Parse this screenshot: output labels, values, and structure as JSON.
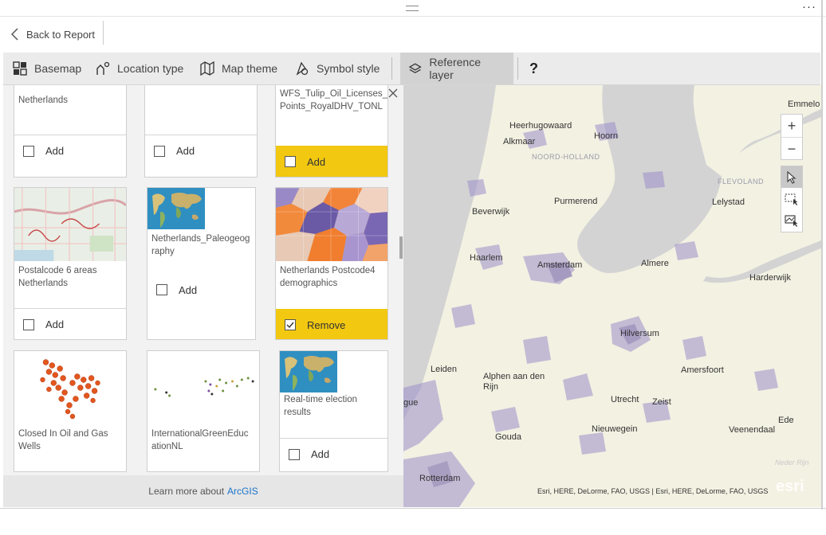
{
  "nav": {
    "back_label": "Back to Report"
  },
  "window": {
    "more_glyph": "···"
  },
  "toolbar": {
    "items": [
      {
        "label": "Basemap",
        "icon": "basemap-icon"
      },
      {
        "label": "Location type",
        "icon": "location-type-icon"
      },
      {
        "label": "Map theme",
        "icon": "map-theme-icon"
      },
      {
        "label": "Symbol style",
        "icon": "symbol-style-icon"
      },
      {
        "label": "Reference layer",
        "icon": "reference-layer-icon",
        "active": true
      }
    ],
    "help": "?"
  },
  "panel": {
    "cards": [
      {
        "title": "Netherlands",
        "action": "Add",
        "checked": false
      },
      {
        "title": "",
        "action": "Add",
        "checked": false
      },
      {
        "title": "WFS_Tulip_Oil_Licenses_\nPoints_RoyalDHV_TONL",
        "action": "Add",
        "checked": false,
        "highlight": true
      },
      {
        "title": "Postalcode 6 areas\nNetherlands",
        "action": "Add",
        "checked": false
      },
      {
        "title": "Netherlands_Paleogeog\nraphy",
        "action": "Add",
        "checked": false
      },
      {
        "title": "Netherlands Postcode4\ndemographics",
        "action": "Remove",
        "checked": true,
        "highlight": true
      },
      {
        "title": "Closed In Oil and Gas\nWells"
      },
      {
        "title": "InternationalGreenEduc\nationNL"
      },
      {
        "title": "Real-time election\nresults",
        "action": "Add",
        "checked": false
      }
    ],
    "footer_text": "Learn more about",
    "footer_link": "ArcGIS"
  },
  "map": {
    "labels": {
      "heerhugowaard": "Heerhugowaard",
      "hoorn": "Hoorn",
      "alkmaar": "Alkmaar",
      "noord_holland": "NOORD-HOLLAND",
      "emmeloord": "Emmelo",
      "flevoland": "FLEVOLAND",
      "lelystad": "Lelystad",
      "beverwijk": "Beverwijk",
      "purmerend": "Purmerend",
      "haarlem": "Haarlem",
      "amsterdam": "Amsterdam",
      "almere": "Almere",
      "harderwijk": "Harderwijk",
      "hilversum": "Hilversum",
      "leiden": "Leiden",
      "alphen": "Alphen aan den\nRijn",
      "amersfoort": "Amersfoort",
      "utrecht": "Utrecht",
      "zeist": "Zeist",
      "ede": "Ede",
      "nieuwegein": "Nieuwegein",
      "veenendaal": "Veenendaal",
      "gouda": "Gouda",
      "gue": "gue",
      "rotterdam": "Rotterdam",
      "neder_rijn": "Neder Rijn"
    },
    "attribution": "Esri, HERE, DeLorme, FAO, USGS | Esri, HERE, DeLorme, FAO, USGS",
    "logo": "esri",
    "zoom_in": "+",
    "zoom_out": "−"
  }
}
